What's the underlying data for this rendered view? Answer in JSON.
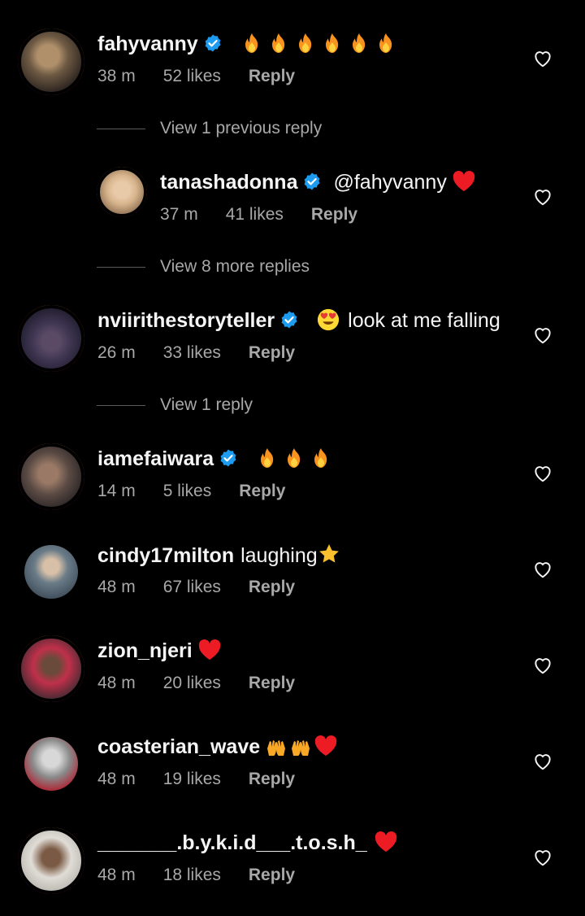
{
  "colors": {
    "background": "#000000",
    "text": "#f5f5f5",
    "secondary": "#a8a8a8",
    "verified": "#1d9bf0",
    "heart_red": "#ed1c24"
  },
  "comments": [
    {
      "username": "fahyvanny",
      "verified": true,
      "text": "",
      "emoji": "fire x6",
      "time": "38 m",
      "likes": "52 likes",
      "reply": "Reply",
      "icon": "heart-outline-icon"
    },
    {
      "username": "tanashadonna",
      "verified": true,
      "text": "@fahyvanny",
      "emoji": "red-heart",
      "time": "37 m",
      "likes": "41 likes",
      "reply": "Reply",
      "icon": "heart-outline-icon"
    },
    {
      "username": "nviirithestoryteller",
      "verified": true,
      "text": "look at me falling",
      "emoji": "heart-eyes",
      "time": "26 m",
      "likes": "33 likes",
      "reply": "Reply",
      "icon": "heart-outline-icon"
    },
    {
      "username": "iamefaiwara",
      "verified": true,
      "text": "",
      "emoji": "fire x3",
      "time": "14 m",
      "likes": "5 likes",
      "reply": "Reply",
      "icon": "heart-outline-icon"
    },
    {
      "username": "cindy17milton",
      "verified": false,
      "text": "laughing",
      "emoji": "star",
      "time": "48 m",
      "likes": "67 likes",
      "reply": "Reply",
      "icon": "heart-outline-icon"
    },
    {
      "username": "zion_njeri",
      "verified": false,
      "text": "",
      "emoji": "red-heart",
      "time": "48 m",
      "likes": "20 likes",
      "reply": "Reply",
      "icon": "heart-outline-icon"
    },
    {
      "username": "coasterian_wave",
      "verified": false,
      "text": "",
      "emoji": "raised-hands x2, red-heart",
      "time": "48 m",
      "likes": "19 likes",
      "reply": "Reply",
      "icon": "heart-outline-icon"
    },
    {
      "username": "_______.b.y.k.i.d___.t.o.s.h_",
      "verified": false,
      "text": "",
      "emoji": "red-heart",
      "time": "48 m",
      "likes": "18 likes",
      "reply": "Reply",
      "icon": "heart-outline-icon"
    }
  ],
  "view_links": {
    "previous_reply": "View 1 previous reply",
    "more_replies": "View 8 more replies",
    "one_reply": "View 1 reply"
  }
}
